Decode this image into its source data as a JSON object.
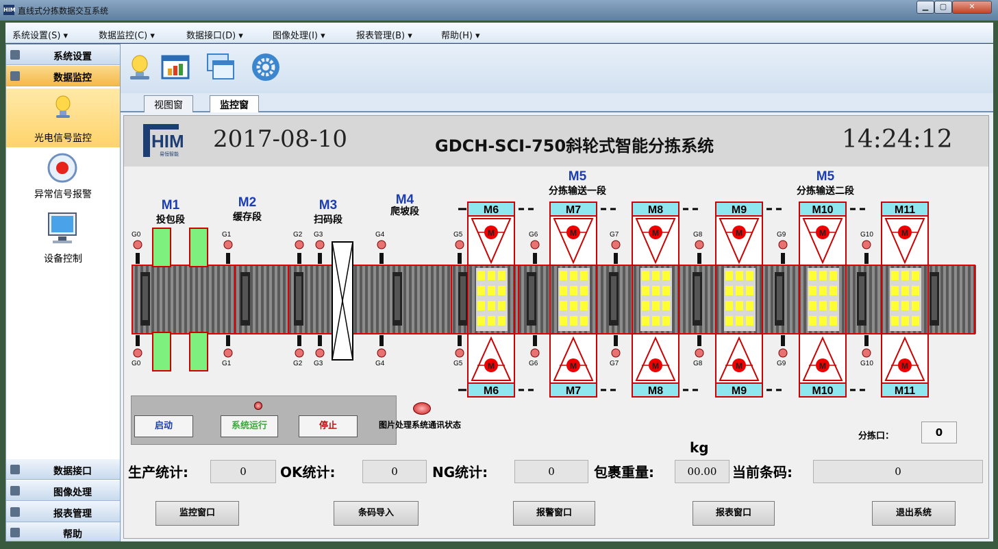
{
  "window": {
    "title": "直线式分拣数据交互系统",
    "icon": "HIM",
    "minimize": "▁",
    "maximize": "▢",
    "close": "✕"
  },
  "menu": [
    "系统设置(S) ▾",
    "数据监控(C) ▾",
    "数据接口(D) ▾",
    "图像处理(I) ▾",
    "报表管理(B) ▾",
    "帮助(H) ▾"
  ],
  "sidebar": {
    "top_categories": [
      {
        "label": "系统设置",
        "icon": "gear-icon"
      },
      {
        "label": "数据监控",
        "icon": "monitor-icon",
        "active": true
      }
    ],
    "items": [
      {
        "label": "光电信号监控",
        "icon": "lightbulb-icon",
        "selected": true
      },
      {
        "label": "异常信号报警",
        "icon": "alarm-icon"
      },
      {
        "label": "设备控制",
        "icon": "computer-icon"
      }
    ],
    "bottom_categories": [
      {
        "label": "数据接口",
        "icon": "interface-icon"
      },
      {
        "label": "图像处理",
        "icon": "image-icon"
      },
      {
        "label": "报表管理",
        "icon": "report-icon"
      },
      {
        "label": "帮助",
        "icon": "help-icon"
      }
    ]
  },
  "toolbar": [
    {
      "name": "lightbulb-icon"
    },
    {
      "name": "chart-window-icon"
    },
    {
      "name": "windows-icon"
    },
    {
      "name": "settings-gear-icon"
    }
  ],
  "tabs": [
    {
      "label": "视图窗",
      "active": false
    },
    {
      "label": "监控窗",
      "active": true
    }
  ],
  "header": {
    "logo": "HIM",
    "logo_sub": "易恒智能",
    "date": "2017-08-10",
    "title": "GDCH-SCI-750斜轮式智能分拣系统",
    "time": "14:24:12"
  },
  "segments": [
    {
      "code": "M1",
      "name": "投包段"
    },
    {
      "code": "M2",
      "name": "缓存段"
    },
    {
      "code": "M3",
      "name": "扫码段"
    },
    {
      "code": "M4",
      "name": "爬坡段"
    }
  ],
  "sort_groups": [
    {
      "code": "M5",
      "name": "分拣输送一段"
    },
    {
      "code": "M5",
      "name": "分拣输送二段"
    }
  ],
  "modules": [
    "M6",
    "M7",
    "M8",
    "M9",
    "M10",
    "M11"
  ],
  "motor_label": "M",
  "sensors_top": [
    "G0",
    "G1",
    "G2",
    "G3",
    "G4",
    "G5",
    "G6",
    "G7",
    "G8",
    "G9",
    "G10"
  ],
  "sensors_bottom": [
    "G0",
    "G1",
    "G2",
    "G3",
    "G4",
    "G5",
    "G6",
    "G7",
    "G8",
    "G9",
    "G10"
  ],
  "controls": {
    "start": "启动",
    "running": "系统运行",
    "stop": "停止"
  },
  "image_status": "图片处理系统通讯状态",
  "sort_port": {
    "label": "分拣口：",
    "value": "0"
  },
  "weight_unit": "kg",
  "stats": {
    "production_label": "生产统计:",
    "production": "0",
    "ok_label": "OK统计:",
    "ok": "0",
    "ng_label": "NG统计:",
    "ng": "0",
    "weight_label": "包裹重量:",
    "weight": "00.00",
    "barcode_label": "当前条码:",
    "barcode": "0"
  },
  "buttons": [
    "监控窗口",
    "条码导入",
    "报警窗口",
    "报表窗口",
    "退出系统"
  ],
  "colors": {
    "accent": "#3399ff",
    "conveyor_border": "#e00000",
    "sorter_cell": "#ffff33",
    "belt_green": "#7ef07e",
    "label_blue": "#1b3db0",
    "module_bg": "#8ee6ee"
  }
}
